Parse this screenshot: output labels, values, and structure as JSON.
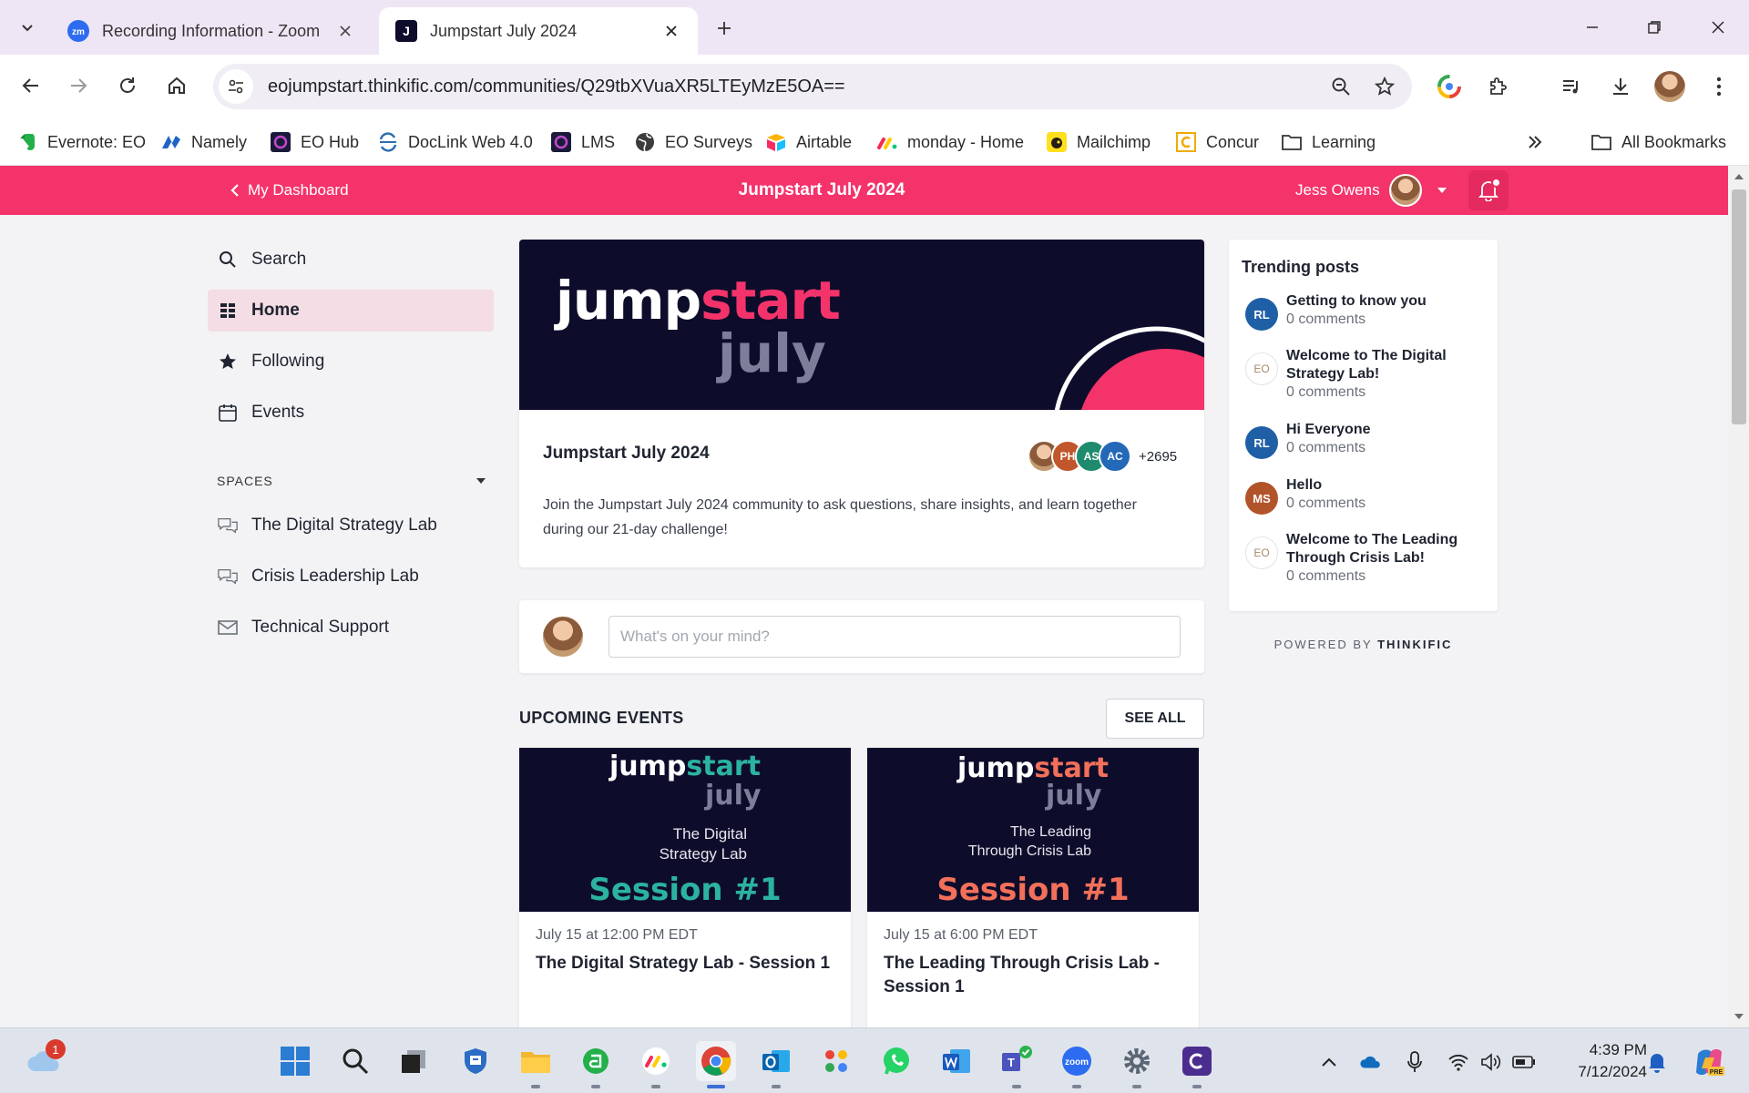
{
  "browser": {
    "tabs": [
      {
        "title": "Recording Information - Zoom",
        "favicon": "zoom-favicon",
        "active": false
      },
      {
        "title": "Jumpstart July 2024",
        "favicon": "thinkific-favicon",
        "active": true
      }
    ],
    "url": "eojumpstart.thinkific.com/communities/Q29tbXVuaXR5LTEyMzE5OA==",
    "bookmarks": [
      {
        "label": "Evernote: EO",
        "icon": "evernote-icon"
      },
      {
        "label": "Namely",
        "icon": "namely-icon"
      },
      {
        "label": "EO Hub",
        "icon": "eo-hub-icon"
      },
      {
        "label": "DocLink Web 4.0",
        "icon": "doclink-icon"
      },
      {
        "label": "LMS",
        "icon": "lms-icon"
      },
      {
        "label": "EO Surveys",
        "icon": "globe-icon"
      },
      {
        "label": "Airtable",
        "icon": "airtable-icon"
      },
      {
        "label": "monday - Home",
        "icon": "monday-icon"
      },
      {
        "label": "Mailchimp",
        "icon": "mailchimp-icon"
      },
      {
        "label": "Concur",
        "icon": "concur-icon"
      },
      {
        "label": "Learning",
        "icon": "folder-icon"
      }
    ],
    "all_bookmarks": "All Bookmarks"
  },
  "header": {
    "back_label": "My Dashboard",
    "title": "Jumpstart July 2024",
    "user_name": "Jess Owens"
  },
  "sidebar": {
    "items": [
      {
        "label": "Search",
        "icon": "search-icon"
      },
      {
        "label": "Home",
        "icon": "grid-icon",
        "active": true
      },
      {
        "label": "Following",
        "icon": "star-icon"
      },
      {
        "label": "Events",
        "icon": "calendar-icon"
      }
    ],
    "spaces_label": "SPACES",
    "spaces": [
      {
        "label": "The Digital Strategy Lab",
        "icon": "chat-bubbles-icon"
      },
      {
        "label": "Crisis Leadership Lab",
        "icon": "chat-bubbles-icon"
      },
      {
        "label": "Technical Support",
        "icon": "mail-icon"
      }
    ]
  },
  "hero": {
    "logo_jump": "jump",
    "logo_start": "start",
    "logo_july": "july",
    "title": "Jumpstart July 2024",
    "members": [
      "PH",
      "AS",
      "AC"
    ],
    "member_count": "+2695",
    "description": "Join the Jumpstart July 2024 community to ask questions, share insights, and learn together during our 21-day challenge!"
  },
  "composer": {
    "placeholder": "What's on your mind?"
  },
  "events": {
    "heading": "UPCOMING EVENTS",
    "see_all": "SEE ALL",
    "items": [
      {
        "banner_sub_1": "The Digital",
        "banner_sub_2": "Strategy Lab",
        "session": "Session #1",
        "accent": "#2bb3a0",
        "date": "July 15 at 12:00 PM EDT",
        "title": "The Digital Strategy Lab - Session 1"
      },
      {
        "banner_sub_1": "The Leading",
        "banner_sub_2": "Through Crisis Lab",
        "session": "Session #1",
        "accent": "#f2705a",
        "date": "July 15 at 6:00 PM EDT",
        "title": "The Leading Through Crisis Lab - Session 1"
      }
    ]
  },
  "trending": {
    "title": "Trending posts",
    "posts": [
      {
        "avatar": "RL",
        "title": "Getting to know you",
        "comments": "0 comments"
      },
      {
        "avatar": "EO",
        "title": "Welcome to The Digital Strategy Lab!",
        "comments": "0 comments"
      },
      {
        "avatar": "RL",
        "title": "Hi Everyone",
        "comments": "0 comments"
      },
      {
        "avatar": "MS",
        "title": "Hello",
        "comments": "0 comments"
      },
      {
        "avatar": "EO",
        "title": "Welcome to The Leading Through Crisis Lab!",
        "comments": "0 comments"
      }
    ],
    "powered_by": "POWERED BY",
    "powered_brand": "THINKIFIC"
  },
  "taskbar": {
    "weather_badge": "1",
    "time": "4:39 PM",
    "date": "7/12/2024"
  },
  "colors": {
    "brand_pink": "#f5336b",
    "hero_navy": "#0e0c2b",
    "active_nav_bg": "#f4dde4"
  }
}
